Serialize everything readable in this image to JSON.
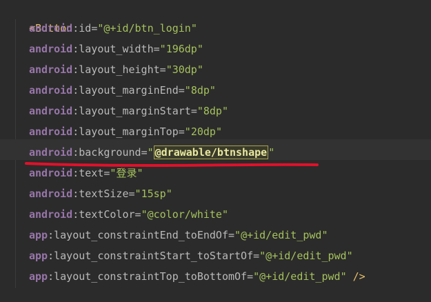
{
  "editor": {
    "tag_open": "<",
    "tag_name": "Button",
    "lines": [
      {
        "ns": "android",
        "name": "id",
        "value": "@+id/btn_login"
      },
      {
        "ns": "android",
        "name": "layout_width",
        "value": "196dp"
      },
      {
        "ns": "android",
        "name": "layout_height",
        "value": "30dp"
      },
      {
        "ns": "android",
        "name": "layout_marginEnd",
        "value": "8dp"
      },
      {
        "ns": "android",
        "name": "layout_marginStart",
        "value": "8dp"
      },
      {
        "ns": "android",
        "name": "layout_marginTop",
        "value": "20dp"
      },
      {
        "ns": "android",
        "name": "background",
        "value": "@drawable/btnshape"
      },
      {
        "ns": "android",
        "name": "text",
        "value": "登录"
      },
      {
        "ns": "android",
        "name": "textSize",
        "value": "15sp"
      },
      {
        "ns": "android",
        "name": "textColor",
        "value": "@color/white"
      },
      {
        "ns": "app",
        "name": "layout_constraintEnd_toEndOf",
        "value": "@+id/edit_pwd"
      },
      {
        "ns": "app",
        "name": "layout_constraintStart_toStartOf",
        "value": "@+id/edit_pwd"
      },
      {
        "ns": "app",
        "name": "layout_constraintTop_toBottomOf",
        "value": "@+id/edit_pwd"
      }
    ],
    "tag_close": "/>",
    "annotation_color": "#e0112b"
  }
}
